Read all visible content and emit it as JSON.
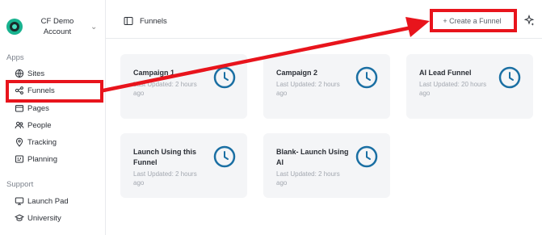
{
  "account": {
    "name": "CF Demo Account"
  },
  "sidebar": {
    "apps_label": "Apps",
    "items": [
      {
        "label": "Sites",
        "icon": "globe-icon"
      },
      {
        "label": "Funnels",
        "icon": "funnel-nodes-icon"
      },
      {
        "label": "Pages",
        "icon": "pages-icon"
      },
      {
        "label": "People",
        "icon": "people-icon"
      },
      {
        "label": "Tracking",
        "icon": "location-pin-icon"
      },
      {
        "label": "Planning",
        "icon": "planning-icon"
      }
    ],
    "support_label": "Support",
    "support_items": [
      {
        "label": "Launch Pad",
        "icon": "monitor-icon"
      },
      {
        "label": "University",
        "icon": "graduation-cap-icon"
      }
    ]
  },
  "header": {
    "breadcrumb": "Funnels",
    "create_button": "+ Create a Funnel"
  },
  "cards": [
    {
      "title": "Campaign 1",
      "subtitle": "Last Updated: 2 hours ago"
    },
    {
      "title": "Campaign 2",
      "subtitle": "Last Updated: 2 hours ago"
    },
    {
      "title": "AI Lead Funnel",
      "subtitle": "Last Updated: 20 hours ago"
    },
    {
      "title": "Launch Using this Funnel",
      "subtitle": "Last Updated: 2 hours ago"
    },
    {
      "title": "Blank- Launch Using AI",
      "subtitle": "Last Updated: 2 hours ago"
    }
  ],
  "colors": {
    "accent_clock": "#1a6fa3",
    "annotation_red": "#e8141c",
    "card_bg": "#f4f5f7"
  }
}
